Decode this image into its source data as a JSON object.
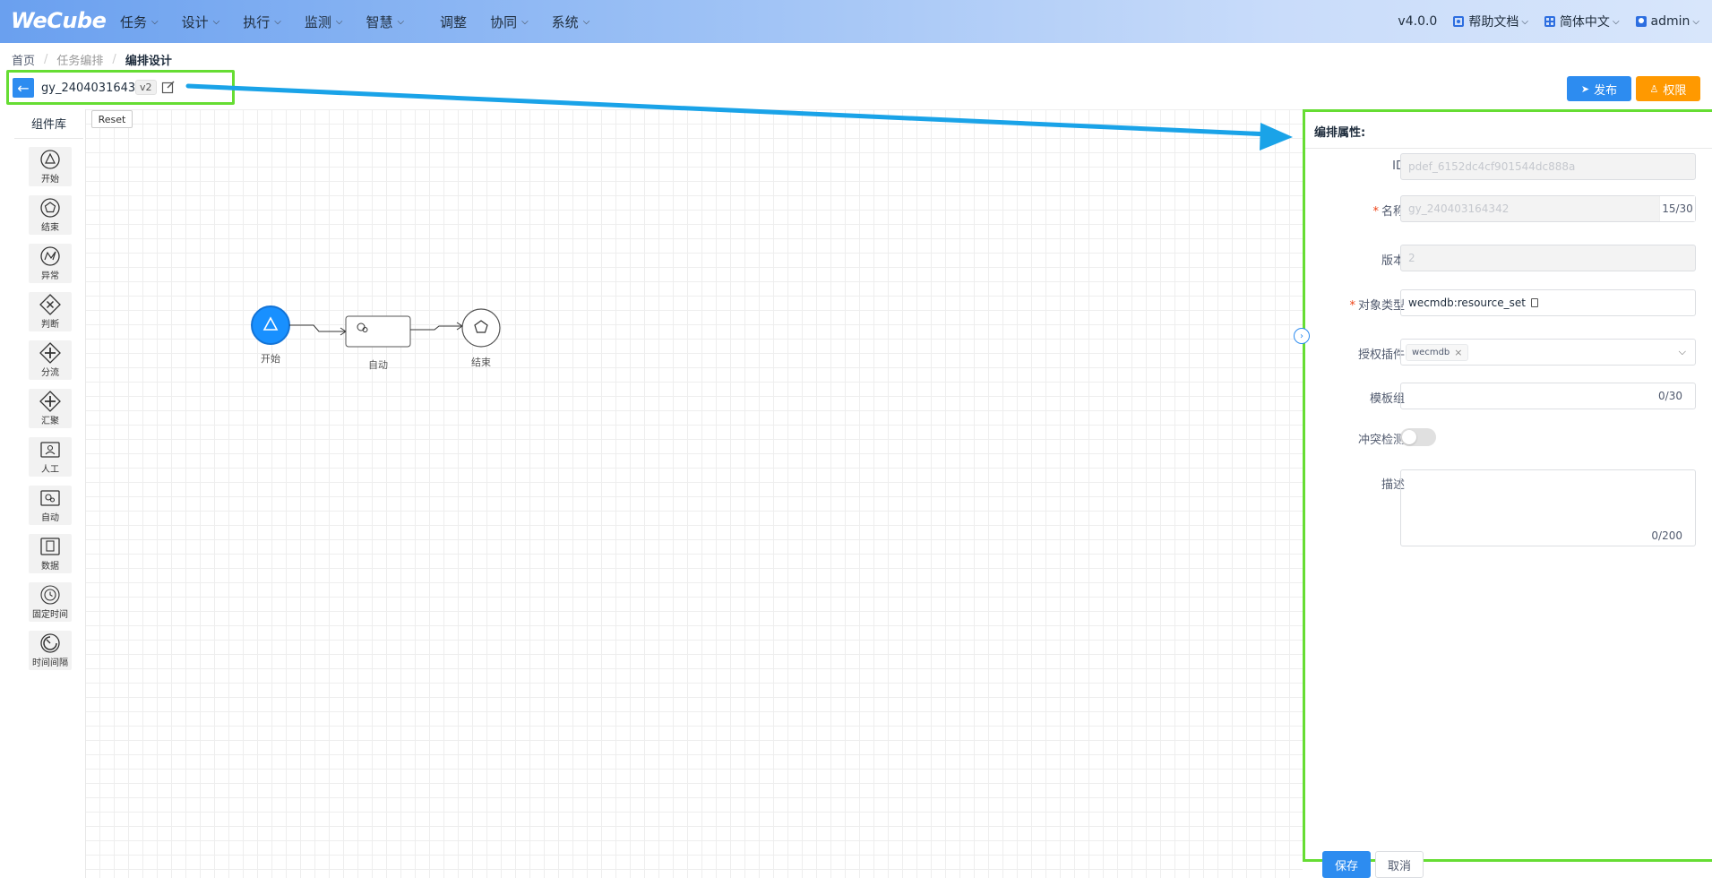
{
  "app": {
    "logo": "WeCube"
  },
  "nav": {
    "menu": [
      {
        "label": "任务",
        "has_dropdown": true
      },
      {
        "label": "设计",
        "has_dropdown": true
      },
      {
        "label": "执行",
        "has_dropdown": true
      },
      {
        "label": "监测",
        "has_dropdown": true
      },
      {
        "label": "智慧",
        "has_dropdown": true
      },
      {
        "label": "调整",
        "has_dropdown": false
      },
      {
        "label": "协同",
        "has_dropdown": true
      },
      {
        "label": "系统",
        "has_dropdown": true
      }
    ],
    "version": "v4.0.0",
    "help": "帮助文档",
    "language": "简体中文",
    "user": "admin"
  },
  "breadcrumb": {
    "items": [
      "首页",
      "任务编排",
      "编排设计"
    ]
  },
  "flow": {
    "name": "gy_240403164342",
    "version_tag": "v2"
  },
  "toolbar": {
    "publish": "发布",
    "permission": "权限",
    "reset": "Reset"
  },
  "palette": {
    "title": "组件库",
    "items": [
      {
        "label": "开始",
        "icon": "start-event-icon"
      },
      {
        "label": "结束",
        "icon": "end-event-icon"
      },
      {
        "label": "异常",
        "icon": "error-event-icon"
      },
      {
        "label": "判断",
        "icon": "decision-gateway-icon"
      },
      {
        "label": "分流",
        "icon": "fork-gateway-icon"
      },
      {
        "label": "汇聚",
        "icon": "merge-gateway-icon"
      },
      {
        "label": "人工",
        "icon": "human-task-icon"
      },
      {
        "label": "自动",
        "icon": "auto-task-icon"
      },
      {
        "label": "数据",
        "icon": "data-task-icon"
      },
      {
        "label": "固定时间",
        "icon": "fixed-time-icon"
      },
      {
        "label": "时间间隔",
        "icon": "time-interval-icon"
      }
    ]
  },
  "diagram": {
    "nodes": [
      {
        "label": "开始",
        "type": "start"
      },
      {
        "label": "自动",
        "type": "auto"
      },
      {
        "label": "结束",
        "type": "end"
      }
    ]
  },
  "panel": {
    "title": "编排属性:",
    "fields": {
      "id": {
        "label": "ID",
        "value": "pdef_6152dc4cf901544dc888a"
      },
      "name": {
        "label": "名称",
        "value": "gy_240403164342",
        "count": "15/30"
      },
      "version": {
        "label": "版本",
        "value": "2"
      },
      "object_type": {
        "label": "对象类型",
        "value": "wecmdb:resource_set"
      },
      "auth_plugin": {
        "label": "授权插件",
        "tag": "wecmdb"
      },
      "template_group": {
        "label": "模板组",
        "count": "0/30"
      },
      "conflict_check": {
        "label": "冲突检测",
        "enabled": false
      },
      "description": {
        "label": "描述",
        "count": "0/200"
      }
    },
    "save": "保存",
    "cancel": "取消"
  },
  "colors": {
    "primary": "#2d8cf0",
    "warning": "#ff9900",
    "highlight": "#66dd33",
    "arrow": "#1aa3e8"
  }
}
